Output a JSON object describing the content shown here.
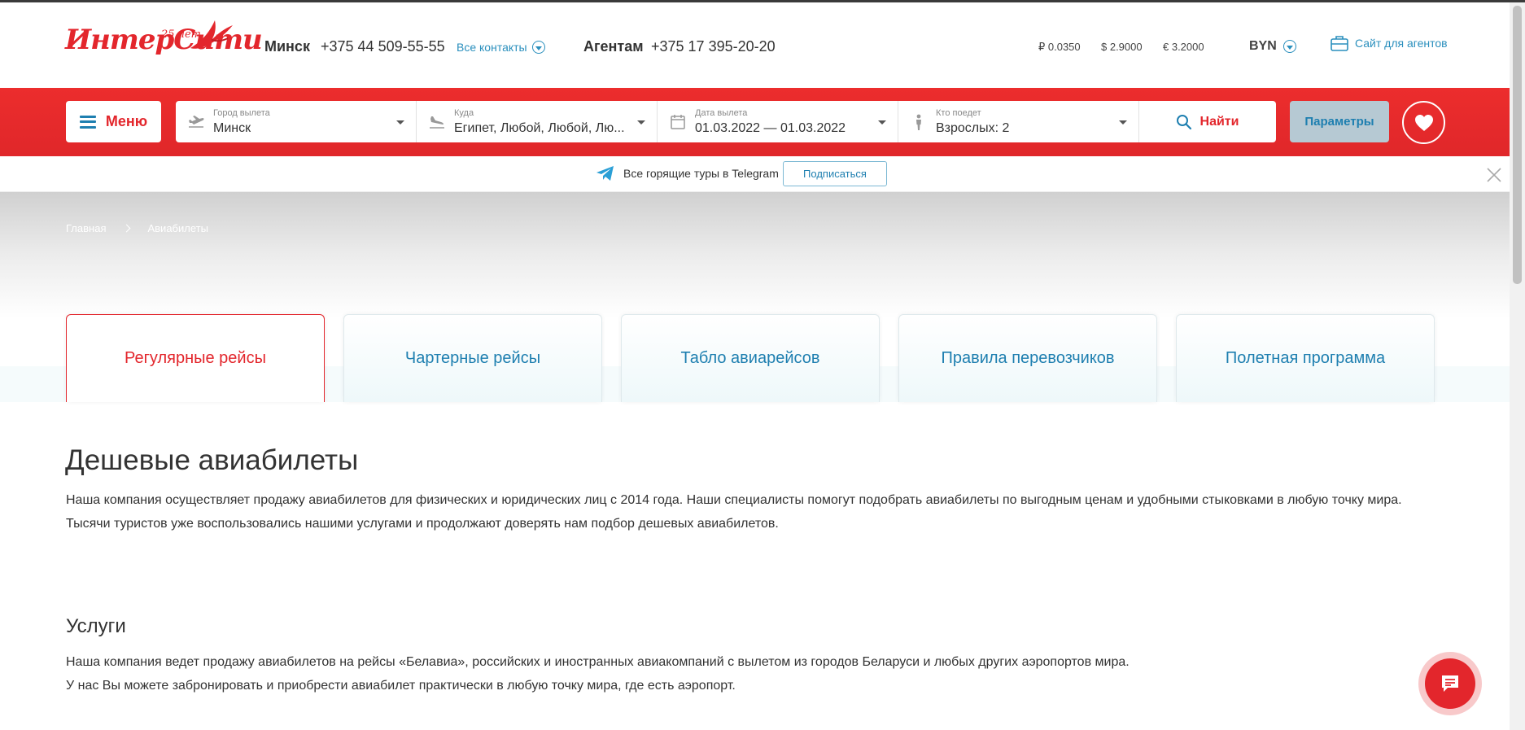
{
  "header": {
    "logo": {
      "text": "ИнтерСити",
      "years": "25 лет"
    },
    "minsk": {
      "city": "Минск",
      "phone": "+375 44 509-55-55",
      "contacts_link": "Все контакты"
    },
    "agents": {
      "label": "Агентам",
      "phone": "+375 17 395-20-20"
    },
    "rates": [
      {
        "label": "₽ 0.0350"
      },
      {
        "label": "$ 2.9000"
      },
      {
        "label": "€ 3.2000"
      }
    ],
    "currency": "BYN",
    "agents_site": "Сайт для агентов"
  },
  "search": {
    "menu_label": "Меню",
    "fields": [
      {
        "label": "Город вылета",
        "value": "Минск",
        "icon": "plane-takeoff-icon"
      },
      {
        "label": "Куда",
        "value": "Египет, Любой, Любой, Лю...",
        "icon": "plane-landing-icon"
      },
      {
        "label": "Дата вылета",
        "value": "01.03.2022 — 01.03.2022",
        "icon": "calendar-icon"
      },
      {
        "label": "Кто поедет",
        "value": "Взрослых: 2",
        "icon": "person-icon"
      }
    ],
    "find_label": "Найти",
    "params_label": "Параметры"
  },
  "telegram": {
    "text": "Все горящие туры в Telegram",
    "subscribe": "Подписаться"
  },
  "breadcrumb": {
    "home": "Главная",
    "current": "Авиабилеты"
  },
  "tabs": [
    {
      "label": "Регулярные рейсы",
      "active": true
    },
    {
      "label": "Чартерные рейсы",
      "active": false
    },
    {
      "label": "Табло авиарейсов",
      "active": false
    },
    {
      "label": "Правила перевозчиков",
      "active": false
    },
    {
      "label": "Полетная программа",
      "active": false
    }
  ],
  "content": {
    "title": "Дешевые авиабилеты",
    "intro": [
      "Наша компания осуществляет продажу авиабилетов для физических и юридических лиц с 2014 года. Наши специалисты помогут подобрать авиабилеты по выгодным ценам и удобными стыковками в любую точку мира.",
      "Тысячи туристов уже воспользовались нашими услугами и продолжают доверять нам подбор дешевых авиабилетов."
    ],
    "services_title": "Услуги",
    "services": [
      "Наша компания ведет продажу авиабилетов на рейсы «Белавиа», российских и иностранных авиакомпаний с вылетом из городов Беларуси и любых других аэропортов мира.",
      "У нас Вы можете забронировать и приобрести авиабилет практически в любую точку мира, где есть аэропорт."
    ]
  },
  "colors": {
    "brand_red": "#e3262c",
    "link_blue": "#1e7fb0",
    "params_bg": "#b6c9d3"
  }
}
